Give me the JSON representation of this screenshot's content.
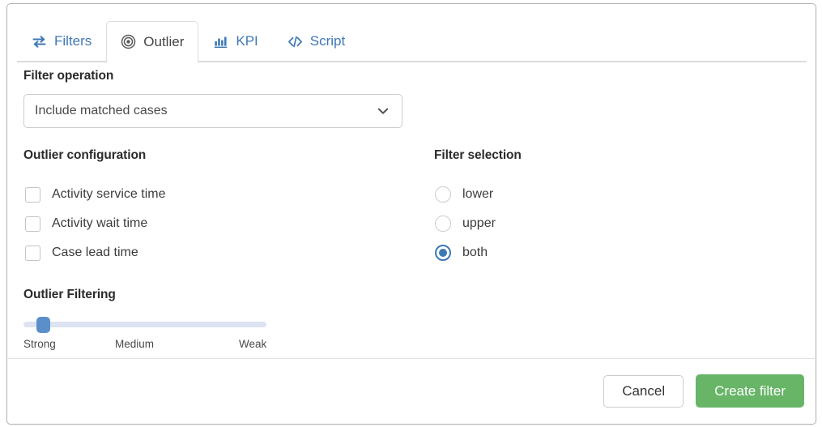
{
  "dialog": {
    "tabs": [
      {
        "label": "Filters",
        "icon": "swap-arrows-icon",
        "active": false
      },
      {
        "label": "Outlier",
        "icon": "target-icon",
        "active": true
      },
      {
        "label": "KPI",
        "icon": "bar-chart-icon",
        "active": false
      },
      {
        "label": "Script",
        "icon": "code-icon",
        "active": false
      }
    ],
    "filter_operation": {
      "heading": "Filter operation",
      "selected": "Include matched cases",
      "chevron": "chevron-down-icon"
    },
    "outlier_configuration": {
      "heading": "Outlier configuration",
      "items": [
        {
          "label": "Activity service time",
          "checked": false
        },
        {
          "label": "Activity wait time",
          "checked": false
        },
        {
          "label": "Case lead time",
          "checked": false
        }
      ]
    },
    "filter_selection": {
      "heading": "Filter selection",
      "items": [
        {
          "label": "lower",
          "selected": false
        },
        {
          "label": "upper",
          "selected": false
        },
        {
          "label": "both",
          "selected": true
        }
      ]
    },
    "outlier_filtering": {
      "heading": "Outlier Filtering",
      "ticks": [
        "Strong",
        "Medium",
        "Weak"
      ],
      "value": "Strong"
    },
    "footer": {
      "cancel_label": "Cancel",
      "create_label": "Create filter"
    },
    "colors": {
      "accent_blue": "#3f78b5",
      "radio_blue": "#3b7ab5",
      "slider_thumb": "#5b8fc9",
      "slider_track": "#dde3f1",
      "primary_green": "#68b568",
      "border_gray": "#cccccc"
    }
  }
}
